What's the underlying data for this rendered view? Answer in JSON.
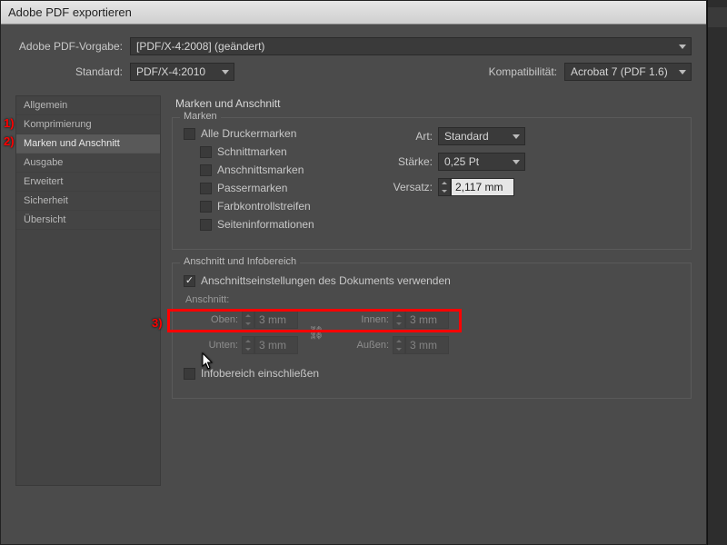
{
  "title": "Adobe PDF exportieren",
  "labels": {
    "preset": "Adobe PDF-Vorgabe:",
    "standard": "Standard:",
    "compat": "Kompatibilität:"
  },
  "values": {
    "preset": "[PDF/X-4:2008] (geändert)",
    "standard": "PDF/X-4:2010",
    "compat": "Acrobat 7 (PDF 1.6)"
  },
  "sidebar": {
    "items": [
      "Allgemein",
      "Komprimierung",
      "Marken und Anschnitt",
      "Ausgabe",
      "Erweitert",
      "Sicherheit",
      "Übersicht"
    ],
    "selected": 2
  },
  "main": {
    "title": "Marken und Anschnitt",
    "marks": {
      "legend": "Marken",
      "all": "Alle Druckermarken",
      "crop": "Schnittmarken",
      "bleedm": "Anschnittsmarken",
      "reg": "Passermarken",
      "color": "Farbkontrollstreifen",
      "pageinfo": "Seiteninformationen",
      "art_lbl": "Art:",
      "art_val": "Standard",
      "weight_lbl": "Stärke:",
      "weight_val": "0,25 Pt",
      "offset_lbl": "Versatz:",
      "offset_val": "2,117 mm"
    },
    "bleed": {
      "legend": "Anschnitt und Infobereich",
      "usedoc": "Anschnittseinstellungen des Dokuments verwenden",
      "sub": "Anschnitt:",
      "top_lbl": "Oben:",
      "bottom_lbl": "Unten:",
      "inner_lbl": "Innen:",
      "outer_lbl": "Außen:",
      "val": "3 mm",
      "slug": "Infobereich einschließen"
    }
  },
  "annot": {
    "a1": "1)",
    "a2": "2)",
    "a3": "3)"
  }
}
